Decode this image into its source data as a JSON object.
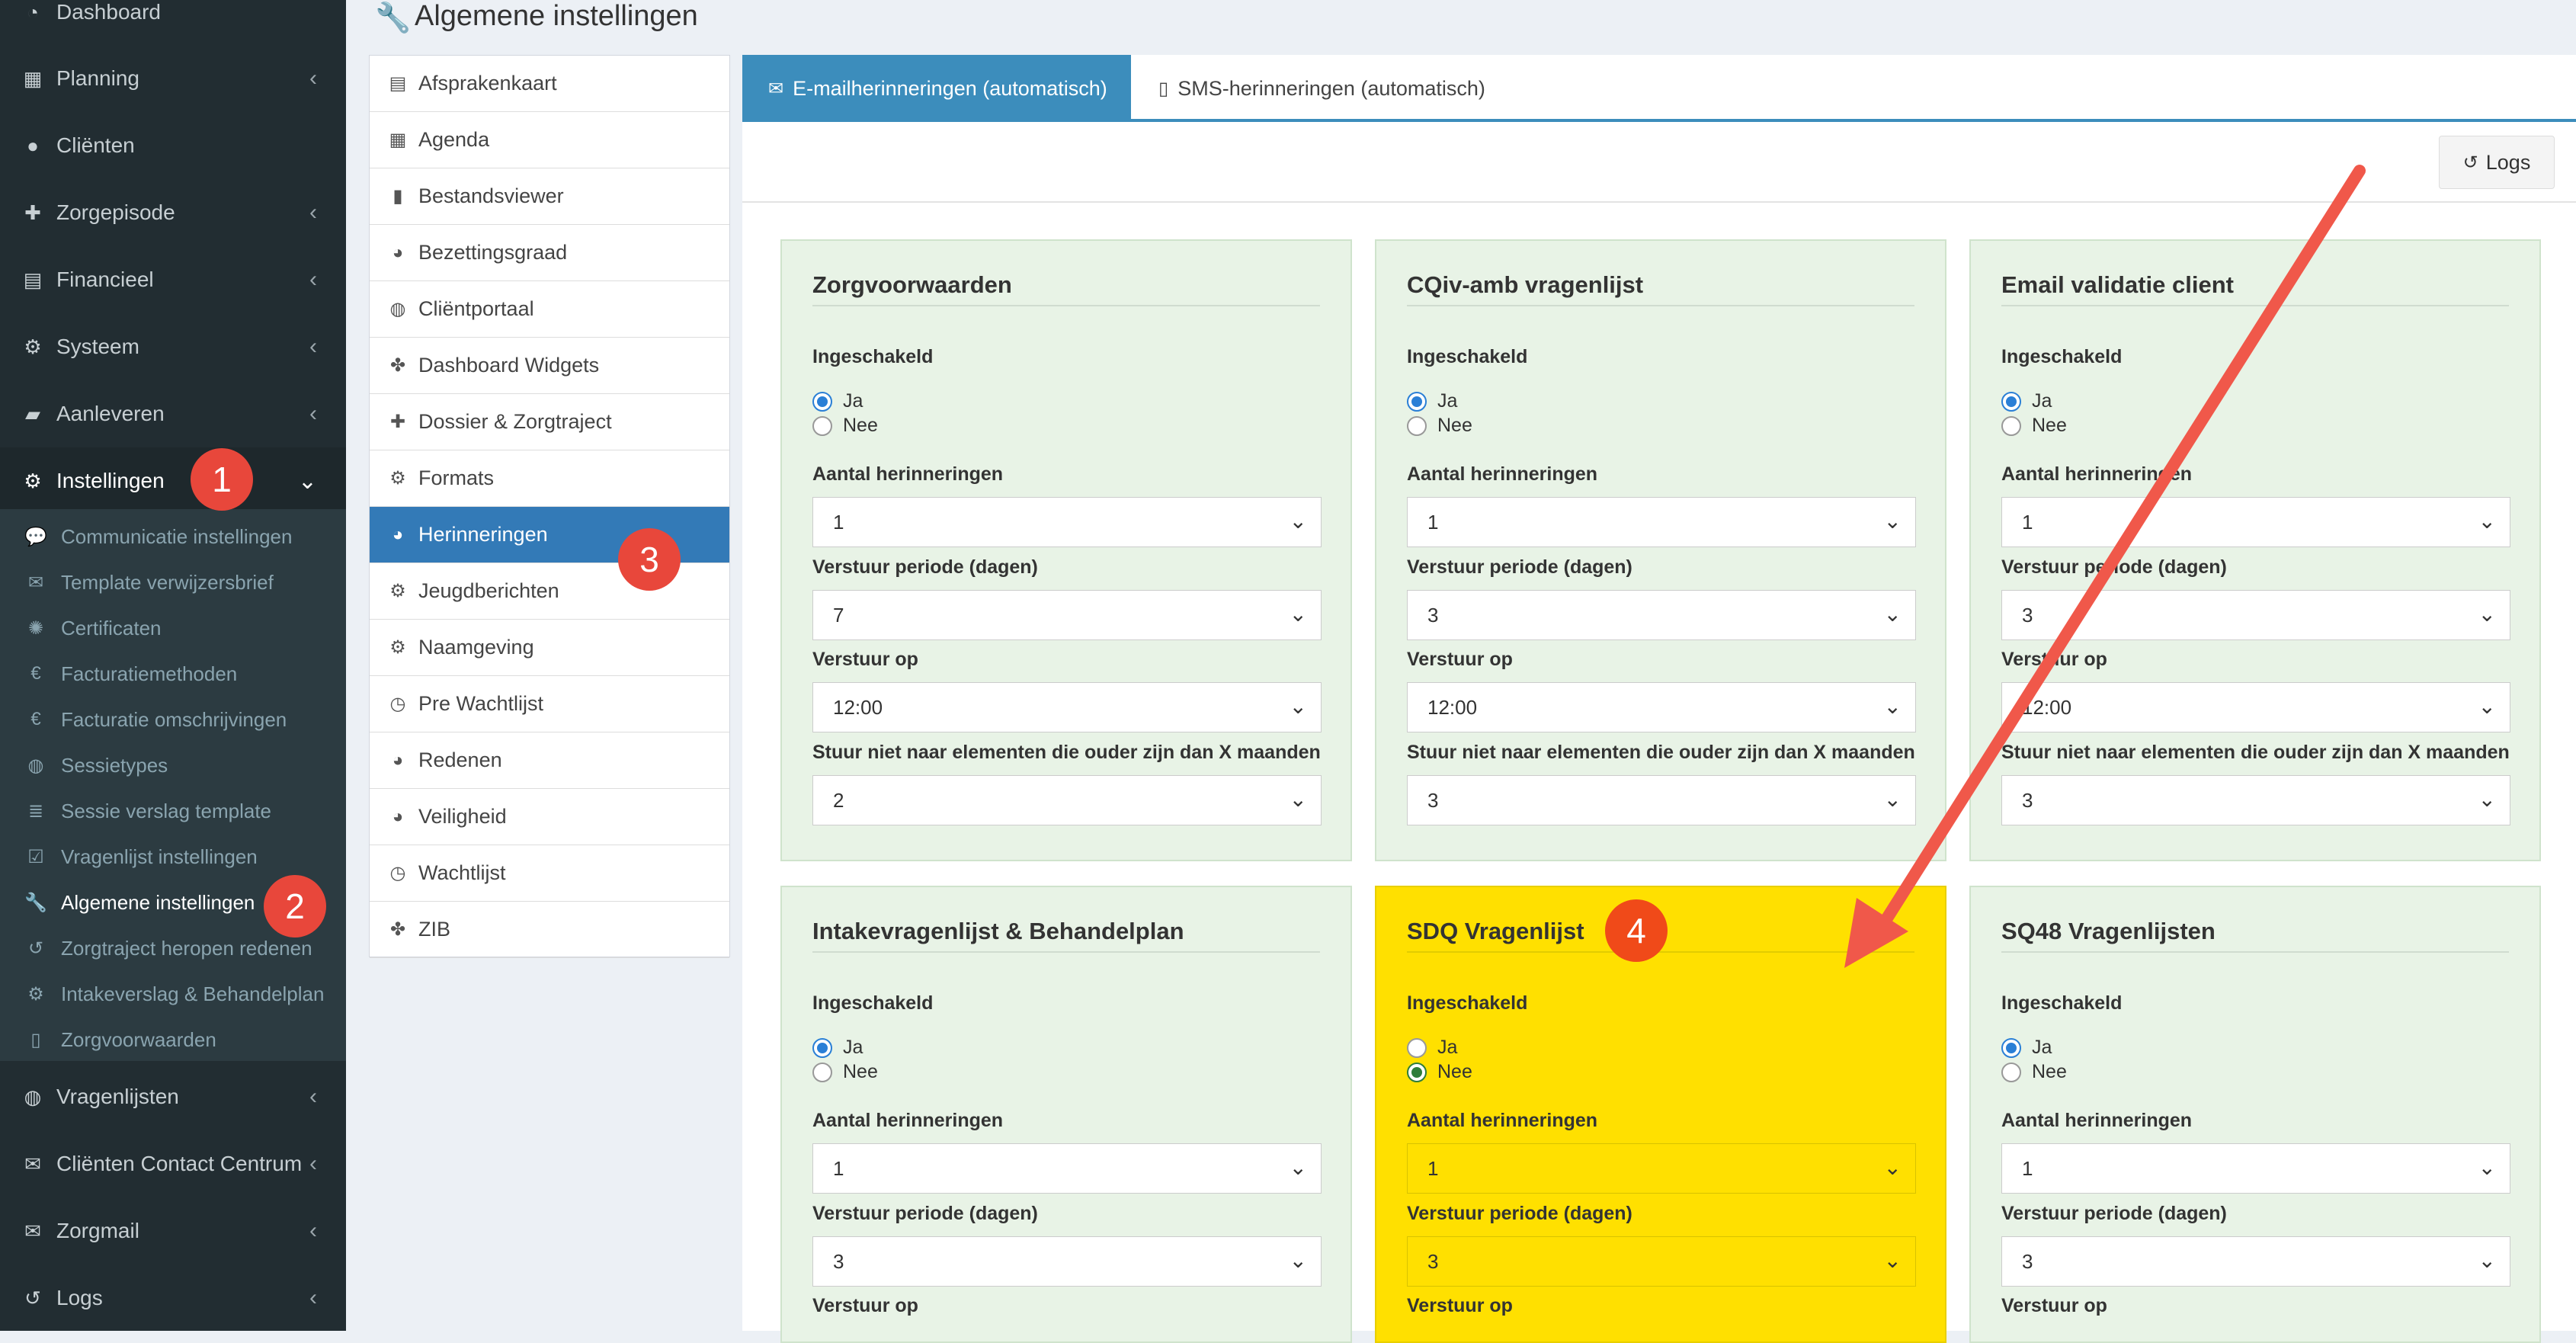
{
  "sidebar": {
    "items": [
      {
        "label": "Dashboard",
        "icon": "dashboard-icon",
        "glyph": "◔",
        "chevron": ""
      },
      {
        "label": "Planning",
        "icon": "calendar-icon",
        "glyph": "▦",
        "chevron": "‹"
      },
      {
        "label": "Cliënten",
        "icon": "user-icon",
        "glyph": "●",
        "chevron": ""
      },
      {
        "label": "Zorgepisode",
        "icon": "medkit-icon",
        "glyph": "✚",
        "chevron": "‹"
      },
      {
        "label": "Financieel",
        "icon": "book-icon",
        "glyph": "▤",
        "chevron": "‹"
      },
      {
        "label": "Systeem",
        "icon": "cogs-icon",
        "glyph": "⚙",
        "chevron": "‹"
      },
      {
        "label": "Aanleveren",
        "icon": "truck-icon",
        "glyph": "▰",
        "chevron": "‹"
      },
      {
        "label": "Instellingen",
        "icon": "gear-icon",
        "glyph": "⚙",
        "chevron": "⌄"
      }
    ],
    "submenu": [
      {
        "label": "Communicatie instellingen",
        "icon": "comments-icon",
        "glyph": "💬"
      },
      {
        "label": "Template verwijzersbrief",
        "icon": "envelope-icon",
        "glyph": "✉"
      },
      {
        "label": "Certificaten",
        "icon": "certificate-icon",
        "glyph": "✺"
      },
      {
        "label": "Facturatiemethoden",
        "icon": "euro-icon",
        "glyph": "€"
      },
      {
        "label": "Facturatie omschrijvingen",
        "icon": "euro-icon",
        "glyph": "€"
      },
      {
        "label": "Sessietypes",
        "icon": "globe-icon",
        "glyph": "◍"
      },
      {
        "label": "Sessie verslag template",
        "icon": "list-icon",
        "glyph": "≣"
      },
      {
        "label": "Vragenlijst instellingen",
        "icon": "check-square-icon",
        "glyph": "☑"
      },
      {
        "label": "Algemene instellingen",
        "icon": "wrench-icon",
        "glyph": "🔧"
      },
      {
        "label": "Zorgtraject heropen redenen",
        "icon": "history-icon",
        "glyph": "↺"
      },
      {
        "label": "Intakeverslag & Behandelplan",
        "icon": "gear-icon",
        "glyph": "⚙"
      },
      {
        "label": "Zorgvoorwaarden",
        "icon": "file-pdf-icon",
        "glyph": "▯"
      }
    ],
    "items_bottom": [
      {
        "label": "Vragenlijsten",
        "icon": "globe-icon",
        "glyph": "◍",
        "chevron": "‹"
      },
      {
        "label": "Cliënten Contact Centrum",
        "icon": "envelope-icon",
        "glyph": "✉",
        "chevron": "‹"
      },
      {
        "label": "Zorgmail",
        "icon": "envelope-icon",
        "glyph": "✉",
        "chevron": "‹"
      },
      {
        "label": "Logs",
        "icon": "history-icon",
        "glyph": "↺",
        "chevron": "‹"
      }
    ]
  },
  "annotations": {
    "one": "1",
    "two": "2",
    "three": "3",
    "four": "4"
  },
  "header": {
    "title": "Algemene instellingen",
    "icon": "wrench-icon"
  },
  "settings_list": [
    {
      "label": "Afsprakenkaart",
      "icon": "list-alt-icon",
      "glyph": "▤"
    },
    {
      "label": "Agenda",
      "icon": "calendar-icon",
      "glyph": "▦"
    },
    {
      "label": "Bestandsviewer",
      "icon": "file-icon",
      "glyph": "▮"
    },
    {
      "label": "Bezettingsgraad",
      "icon": "pie-chart-icon",
      "glyph": "◕"
    },
    {
      "label": "Cliëntportaal",
      "icon": "globe-icon",
      "glyph": "◍"
    },
    {
      "label": "Dashboard Widgets",
      "icon": "puzzle-icon",
      "glyph": "✤"
    },
    {
      "label": "Dossier & Zorgtraject",
      "icon": "medkit-icon",
      "glyph": "✚"
    },
    {
      "label": "Formats",
      "icon": "gear-icon",
      "glyph": "⚙"
    },
    {
      "label": "Herinneringen",
      "icon": "pie-chart-icon",
      "glyph": "◕"
    },
    {
      "label": "Jeugdberichten",
      "icon": "gear-icon",
      "glyph": "⚙"
    },
    {
      "label": "Naamgeving",
      "icon": "gear-icon",
      "glyph": "⚙"
    },
    {
      "label": "Pre Wachtlijst",
      "icon": "clock-icon",
      "glyph": "◷"
    },
    {
      "label": "Redenen",
      "icon": "pie-chart-icon",
      "glyph": "◕"
    },
    {
      "label": "Veiligheid",
      "icon": "pie-chart-icon",
      "glyph": "◕"
    },
    {
      "label": "Wachtlijst",
      "icon": "clock-icon",
      "glyph": "◷"
    },
    {
      "label": "ZIB",
      "icon": "puzzle-icon",
      "glyph": "✤"
    }
  ],
  "tabs": [
    {
      "label": "E-mailherinneringen (automatisch)",
      "icon": "envelope-icon",
      "glyph": "✉"
    },
    {
      "label": "SMS-herinneringen (automatisch)",
      "icon": "mobile-icon",
      "glyph": "▯"
    }
  ],
  "logs_button": {
    "label": "Logs",
    "icon": "history-icon",
    "glyph": "↺"
  },
  "labels": {
    "enabled": "Ingeschakeld",
    "yes": "Ja",
    "no": "Nee",
    "count": "Aantal herinneringen",
    "period": "Verstuur periode (dagen)",
    "send_at": "Verstuur op",
    "exclude": "Stuur niet naar elementen die ouder zijn dan X maanden"
  },
  "cards": [
    {
      "title": "Zorgvoorwaarden",
      "enabled": "Ja",
      "count": "1",
      "period": "7",
      "send_at": "12:00",
      "exclude": "2"
    },
    {
      "title": "CQiv-amb vragenlijst",
      "enabled": "Ja",
      "count": "1",
      "period": "3",
      "send_at": "12:00",
      "exclude": "3"
    },
    {
      "title": "Email validatie client",
      "enabled": "Ja",
      "count": "1",
      "period": "3",
      "send_at": "12:00",
      "exclude": "3"
    },
    {
      "title": "Intakevragenlijst & Behandelplan",
      "enabled": "Ja",
      "count": "1",
      "period": "3"
    },
    {
      "title": "SDQ Vragenlijst",
      "enabled": "Nee",
      "count": "1",
      "period": "3"
    },
    {
      "title": "SQ48 Vragenlijsten",
      "enabled": "Ja",
      "count": "1",
      "period": "3"
    }
  ],
  "colors": {
    "sidebar": "#222d32",
    "primary": "#3c8dbc",
    "highlight": "#ffe000",
    "card": "#e8f3e6",
    "badge": "#e8473b",
    "arrow": "#f0584a"
  }
}
